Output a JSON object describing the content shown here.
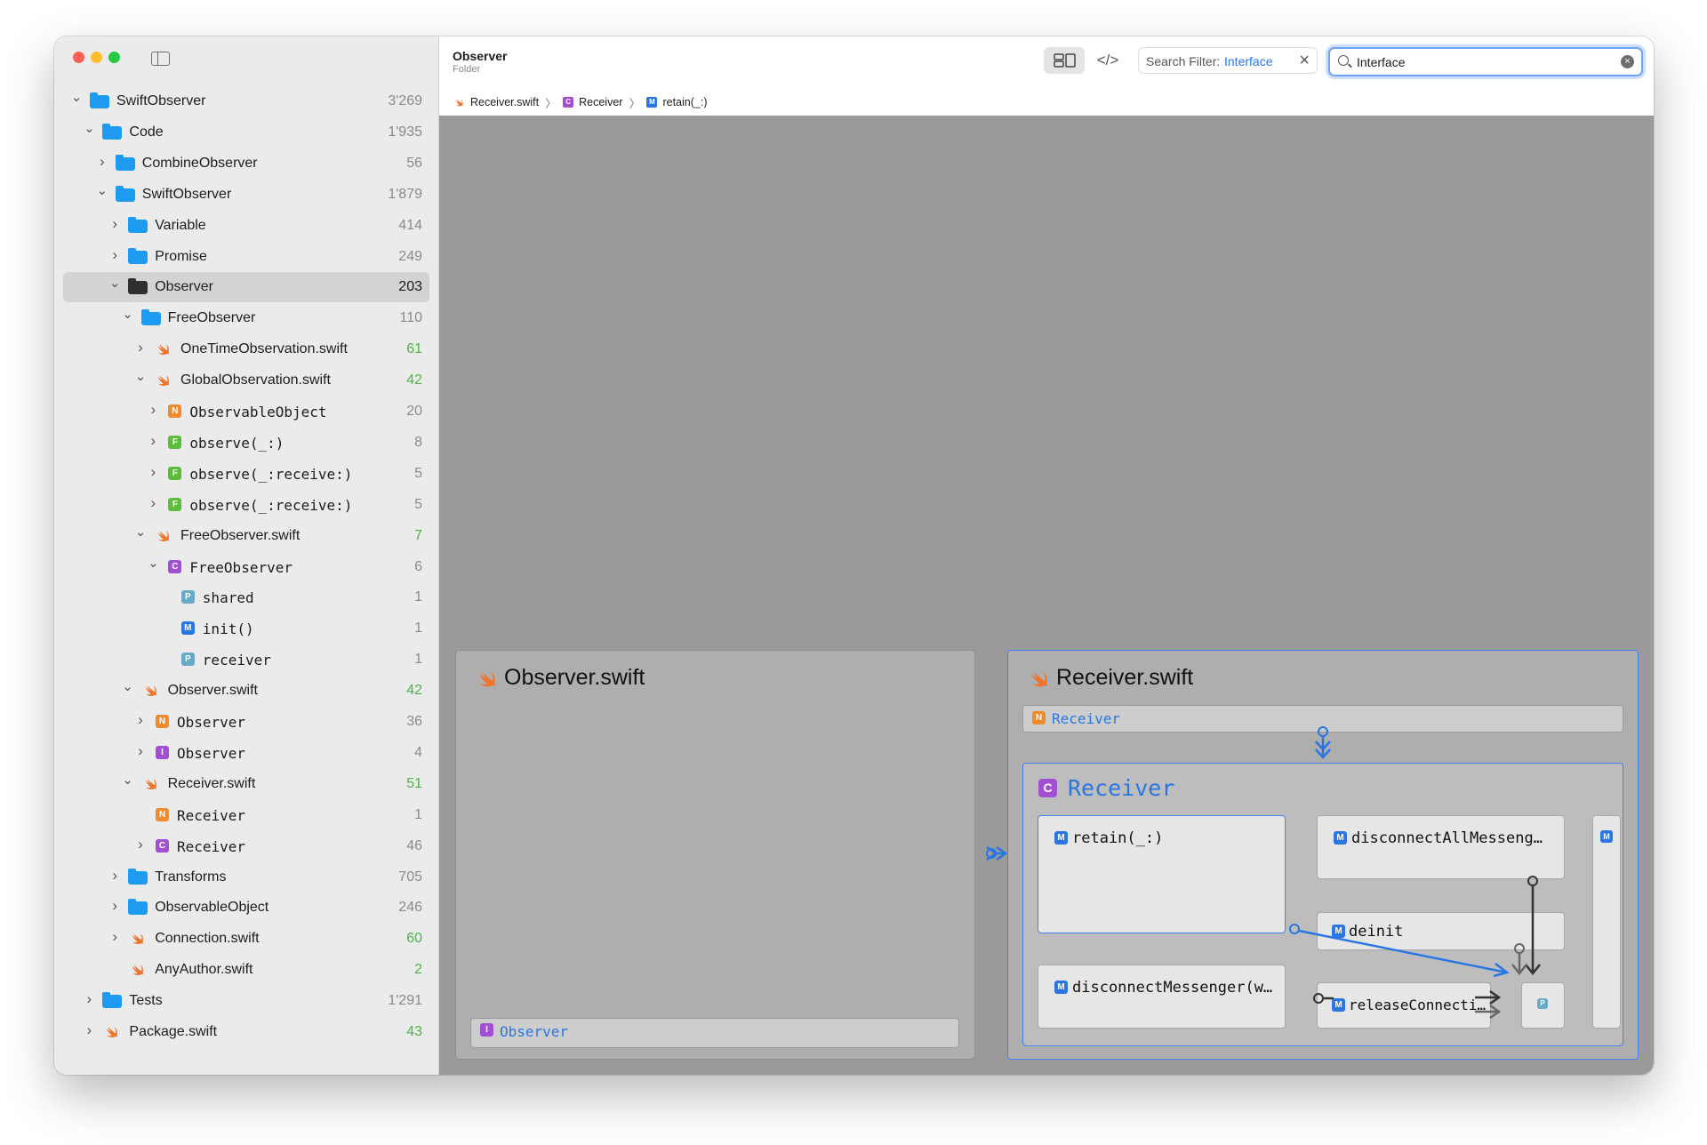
{
  "window": {
    "title": "Observer",
    "subtitle": "Folder"
  },
  "toolbar": {
    "layout_icon": "layout-columns-icon",
    "code_icon": "code-brackets-icon",
    "code_glyph": "</>",
    "filter_label": "Search Filter:",
    "filter_value": "Interface",
    "search_value": "Interface"
  },
  "breadcrumbs": [
    {
      "label": "Receiver.swift",
      "kind": "swift"
    },
    {
      "label": "Receiver",
      "kind": "C"
    },
    {
      "label": "retain(_:)",
      "kind": "M"
    }
  ],
  "tree": [
    {
      "label": "SwiftObserver",
      "count": "3'269",
      "kind": "folder",
      "depth": 0,
      "chevron": "open"
    },
    {
      "label": "Code",
      "count": "1'935",
      "kind": "folder",
      "depth": 1,
      "chevron": "open"
    },
    {
      "label": "CombineObserver",
      "count": "56",
      "kind": "folder",
      "depth": 2,
      "chevron": "closed"
    },
    {
      "label": "SwiftObserver",
      "count": "1'879",
      "kind": "folder",
      "depth": 2,
      "chevron": "open"
    },
    {
      "label": "Variable",
      "count": "414",
      "kind": "folder",
      "depth": 3,
      "chevron": "closed"
    },
    {
      "label": "Promise",
      "count": "249",
      "kind": "folder",
      "depth": 3,
      "chevron": "closed"
    },
    {
      "label": "Observer",
      "count": "203",
      "kind": "folder-dark",
      "depth": 3,
      "chevron": "open",
      "selected": true
    },
    {
      "label": "FreeObserver",
      "count": "110",
      "kind": "folder",
      "depth": 4,
      "chevron": "open"
    },
    {
      "label": "OneTimeObservation.swift",
      "count": "61",
      "kind": "swift",
      "depth": 5,
      "chevron": "closed",
      "green": true
    },
    {
      "label": "GlobalObservation.swift",
      "count": "42",
      "kind": "swift",
      "depth": 5,
      "chevron": "open",
      "green": true
    },
    {
      "label": "ObservableObject",
      "count": "20",
      "kind": "N",
      "depth": 6,
      "chevron": "closed",
      "mono": true
    },
    {
      "label": "observe(_:)",
      "count": "8",
      "kind": "F",
      "depth": 6,
      "chevron": "closed",
      "mono": true
    },
    {
      "label": "observe(_:receive:)",
      "count": "5",
      "kind": "F",
      "depth": 6,
      "chevron": "closed",
      "mono": true
    },
    {
      "label": "observe(_:receive:)",
      "count": "5",
      "kind": "F",
      "depth": 6,
      "chevron": "closed",
      "mono": true
    },
    {
      "label": "FreeObserver.swift",
      "count": "7",
      "kind": "swift",
      "depth": 5,
      "chevron": "open",
      "green": true
    },
    {
      "label": "FreeObserver",
      "count": "6",
      "kind": "C",
      "depth": 6,
      "chevron": "open",
      "mono": true
    },
    {
      "label": "shared",
      "count": "1",
      "kind": "P",
      "depth": 7,
      "chevron": "none",
      "mono": true
    },
    {
      "label": "init()",
      "count": "1",
      "kind": "M",
      "depth": 7,
      "chevron": "none",
      "mono": true
    },
    {
      "label": "receiver",
      "count": "1",
      "kind": "P",
      "depth": 7,
      "chevron": "none",
      "mono": true
    },
    {
      "label": "Observer.swift",
      "count": "42",
      "kind": "swift",
      "depth": 4,
      "chevron": "open",
      "green": true
    },
    {
      "label": "Observer",
      "count": "36",
      "kind": "N",
      "depth": 5,
      "chevron": "closed",
      "mono": true
    },
    {
      "label": "Observer",
      "count": "4",
      "kind": "I",
      "depth": 5,
      "chevron": "closed",
      "mono": true
    },
    {
      "label": "Receiver.swift",
      "count": "51",
      "kind": "swift",
      "depth": 4,
      "chevron": "open",
      "green": true
    },
    {
      "label": "Receiver",
      "count": "1",
      "kind": "N",
      "depth": 5,
      "chevron": "none",
      "mono": true
    },
    {
      "label": "Receiver",
      "count": "46",
      "kind": "C",
      "depth": 5,
      "chevron": "closed",
      "mono": true
    },
    {
      "label": "Transforms",
      "count": "705",
      "kind": "folder",
      "depth": 3,
      "chevron": "closed"
    },
    {
      "label": "ObservableObject",
      "count": "246",
      "kind": "folder",
      "depth": 3,
      "chevron": "closed"
    },
    {
      "label": "Connection.swift",
      "count": "60",
      "kind": "swift",
      "depth": 3,
      "chevron": "closed",
      "green": true
    },
    {
      "label": "AnyAuthor.swift",
      "count": "2",
      "kind": "swift",
      "depth": 3,
      "chevron": "none",
      "green": true
    },
    {
      "label": "Tests",
      "count": "1'291",
      "kind": "folder",
      "depth": 1,
      "chevron": "closed"
    },
    {
      "label": "Package.swift",
      "count": "43",
      "kind": "swift",
      "depth": 1,
      "chevron": "closed",
      "green": true
    }
  ],
  "canvas": {
    "observer_panel": {
      "title": "Observer.swift",
      "bar_label": "Observer",
      "bar_kind": "I"
    },
    "receiver_panel": {
      "title": "Receiver.swift",
      "bar_label": "Receiver",
      "bar_kind": "N",
      "class_title": "Receiver",
      "class_kind": "C",
      "members": {
        "retain": "retain(_:)",
        "disconnect_all": "disconnectAllMesseng…",
        "deinit": "deinit",
        "disconnect_messenger": "disconnectMessenger(w…",
        "release_connection": "releaseConnecti…",
        "property_badge": "P",
        "method_badge": "M"
      }
    }
  },
  "colors": {
    "accent": "#2a77e3",
    "selection_border": "#3f83f5",
    "count_green": "#4bb543",
    "folder_blue": "#1c9bf0",
    "swift_orange": "#f0742c",
    "canvas_bg": "#9a9a9a"
  }
}
